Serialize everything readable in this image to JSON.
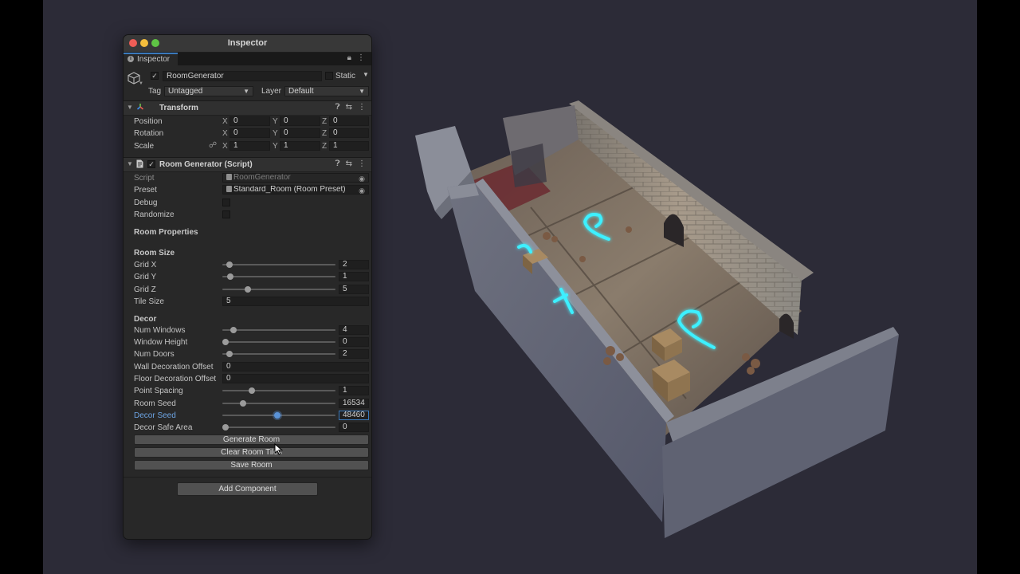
{
  "window": {
    "title": "Inspector"
  },
  "tab": {
    "label": "Inspector"
  },
  "gameobject": {
    "name": "RoomGenerator",
    "static_label": "Static",
    "tag_label": "Tag",
    "tag_value": "Untagged",
    "layer_label": "Layer",
    "layer_value": "Default"
  },
  "transform": {
    "title": "Transform",
    "rows": [
      {
        "label": "Position",
        "x": "0",
        "y": "0",
        "z": "0"
      },
      {
        "label": "Rotation",
        "x": "0",
        "y": "0",
        "z": "0"
      },
      {
        "label": "Scale",
        "x": "1",
        "y": "1",
        "z": "1"
      }
    ],
    "axis": {
      "x": "X",
      "y": "Y",
      "z": "Z"
    }
  },
  "room_generator": {
    "title": "Room Generator (Script)",
    "script_label": "Script",
    "script_value": "RoomGenerator",
    "preset_label": "Preset",
    "preset_value": "Standard_Room (Room Preset)",
    "debug_label": "Debug",
    "randomize_label": "Randomize",
    "room_properties_heading": "Room Properties",
    "room_size_heading": "Room Size",
    "grid_x_label": "Grid X",
    "grid_x_value": "2",
    "grid_y_label": "Grid Y",
    "grid_y_value": "1",
    "grid_z_label": "Grid Z",
    "grid_z_value": "5",
    "tile_size_label": "Tile Size",
    "tile_size_value": "5",
    "decor_heading": "Decor",
    "num_windows_label": "Num Windows",
    "num_windows_value": "4",
    "window_height_label": "Window Height",
    "window_height_value": "0",
    "num_doors_label": "Num Doors",
    "num_doors_value": "2",
    "wall_decoration_offset_label": "Wall Decoration Offset",
    "wall_decoration_offset_value": "0",
    "floor_decoration_offset_label": "Floor Decoration Offset",
    "floor_decoration_offset_value": "0",
    "point_spacing_label": "Point Spacing",
    "point_spacing_value": "1",
    "room_seed_label": "Room Seed",
    "room_seed_value": "16534",
    "decor_seed_label": "Decor Seed",
    "decor_seed_value": "48460",
    "decor_safe_area_label": "Decor Safe Area",
    "decor_safe_area_value": "0",
    "generate_room_label": "Generate Room",
    "clear_room_tiles_label": "Clear Room Tiles",
    "save_room_label": "Save Room"
  },
  "add_component_label": "Add Component",
  "colors": {
    "accent": "#3a79bb",
    "rune_glow": "#3ef0ff",
    "background": "#2c2b37"
  }
}
